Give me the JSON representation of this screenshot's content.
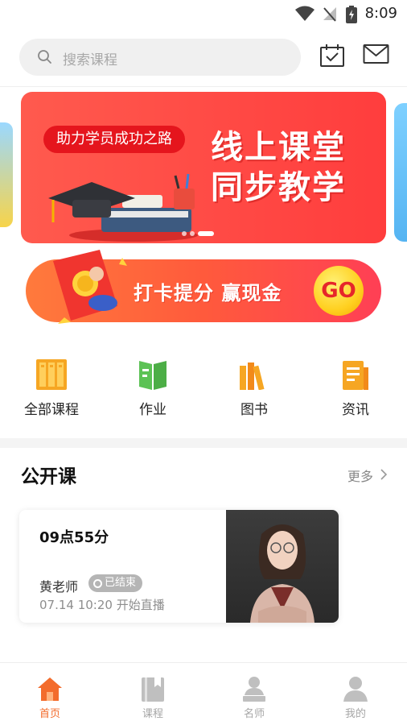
{
  "status_bar": {
    "time": "8:09"
  },
  "search": {
    "placeholder": "搜索课程"
  },
  "banner": {
    "pill_text": "助力学员成功之路",
    "headline_1": "线上课堂",
    "headline_2": "同步教学"
  },
  "checkin": {
    "text": "打卡提分 赢现金",
    "go_label": "GO"
  },
  "quick_menu": [
    {
      "label": "全部课程",
      "icon": "bookshelf-icon"
    },
    {
      "label": "作业",
      "icon": "open-book-icon"
    },
    {
      "label": "图书",
      "icon": "books-icon"
    },
    {
      "label": "资讯",
      "icon": "document-icon"
    }
  ],
  "public_courses": {
    "title": "公开课",
    "more_label": "更多",
    "items": [
      {
        "title": "09点55分",
        "teacher": "黄老师",
        "status": "已结束",
        "time": "07.14 10:20 开始直播"
      }
    ]
  },
  "tabbar": {
    "items": [
      {
        "label": "首页",
        "icon": "home-icon",
        "active": true
      },
      {
        "label": "课程",
        "icon": "course-book-icon",
        "active": false
      },
      {
        "label": "名师",
        "icon": "teacher-icon",
        "active": false
      },
      {
        "label": "我的",
        "icon": "person-icon",
        "active": false
      }
    ]
  },
  "colors": {
    "accent": "#f36c2c",
    "banner_red": "#ff4a45",
    "inactive_tab": "#a6a6a6"
  }
}
